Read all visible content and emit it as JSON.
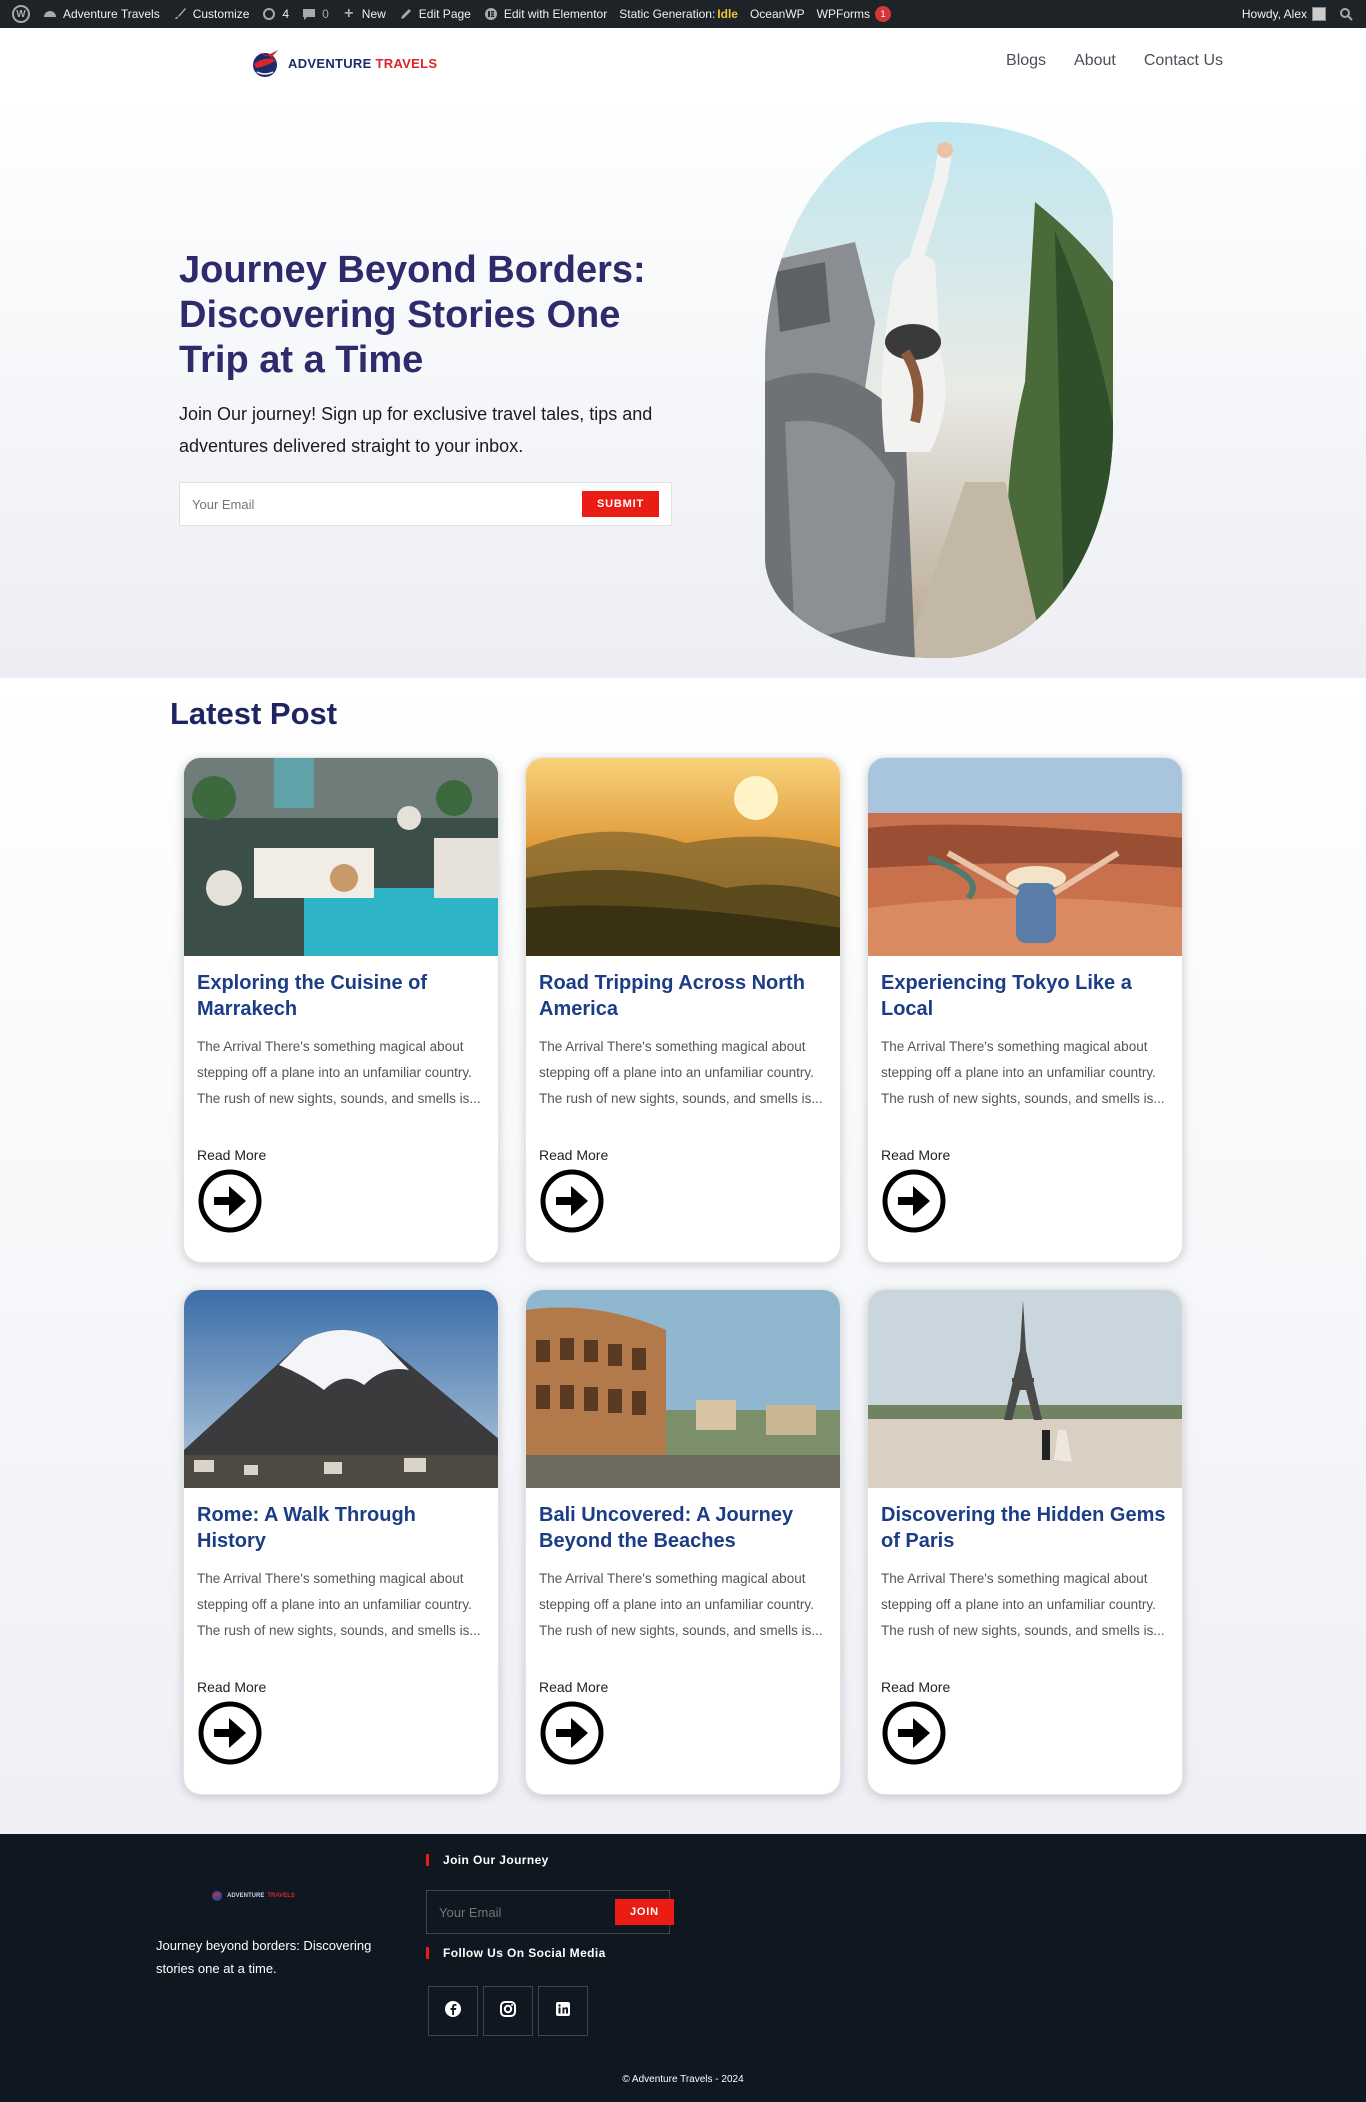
{
  "adminbar": {
    "site_name": "Adventure Travels",
    "customize": "Customize",
    "updates_count": "4",
    "comments_count": "0",
    "new": "New",
    "edit_page": "Edit Page",
    "edit_elementor": "Edit with Elementor",
    "static_gen_label": "Static Generation:",
    "static_gen_status": "Idle",
    "oceanwp": "OceanWP",
    "wpforms": "WPForms",
    "wpforms_badge": "1",
    "howdy": "Howdy, Alex"
  },
  "header": {
    "logo_part1": "ADVENTURE",
    "logo_part2": "TRAVELS",
    "nav": [
      "Blogs",
      "About",
      "Contact Us"
    ]
  },
  "hero": {
    "title": "Journey Beyond Borders: Discovering Stories One Trip at a Time",
    "subtitle": "Join Our journey! Sign up for exclusive travel tales, tips and adventures delivered straight to your inbox.",
    "email_placeholder": "Your Email",
    "submit": "SUBMIT"
  },
  "latest": {
    "heading": "Latest Post",
    "posts": [
      {
        "title": "Exploring the Cuisine of Marrakech",
        "excerpt": "The Arrival There's something magical about stepping off a plane into an unfamiliar country. The rush of new sights, sounds, and smells is...",
        "more": "Read More"
      },
      {
        "title": "Road Tripping Across North America",
        "excerpt": "The Arrival There's something magical about stepping off a plane into an unfamiliar country. The rush of new sights, sounds, and smells is...",
        "more": "Read More"
      },
      {
        "title": "Experiencing Tokyo Like a Local",
        "excerpt": "The Arrival There's something magical about stepping off a plane into an unfamiliar country. The rush of new sights, sounds, and smells is...",
        "more": "Read More"
      },
      {
        "title": "Rome: A Walk Through History",
        "excerpt": "The Arrival There's something magical about stepping off a plane into an unfamiliar country. The rush of new sights, sounds, and smells is...",
        "more": "Read More"
      },
      {
        "title": "Bali Uncovered: A Journey Beyond the Beaches",
        "excerpt": "The Arrival There's something magical about stepping off a plane into an unfamiliar country. The rush of new sights, sounds, and smells is...",
        "more": "Read More"
      },
      {
        "title": "Discovering the Hidden Gems of Paris",
        "excerpt": "The Arrival There's something magical about stepping off a plane into an unfamiliar country. The rush of new sights, sounds, and smells is...",
        "more": "Read More"
      }
    ]
  },
  "footer": {
    "logo_part1": "ADVENTURE",
    "logo_part2": "TRAVELS",
    "tagline": "Journey beyond borders: Discovering stories one at a time.",
    "join_heading": "Join Our Journey",
    "email_placeholder": "Your Email",
    "join_button": "JOIN",
    "social_heading": "Follow Us On Social Media",
    "social": [
      "facebook-icon",
      "instagram-icon",
      "linkedin-icon"
    ],
    "copyright": "© Adventure Travels - 2024"
  },
  "colors": {
    "accent_red": "#ea1c14",
    "title_navy": "#2e2a6b",
    "card_title_blue": "#1c3d86",
    "footer_bg": "#0f1720",
    "adminbar_bg": "#1d2327"
  }
}
